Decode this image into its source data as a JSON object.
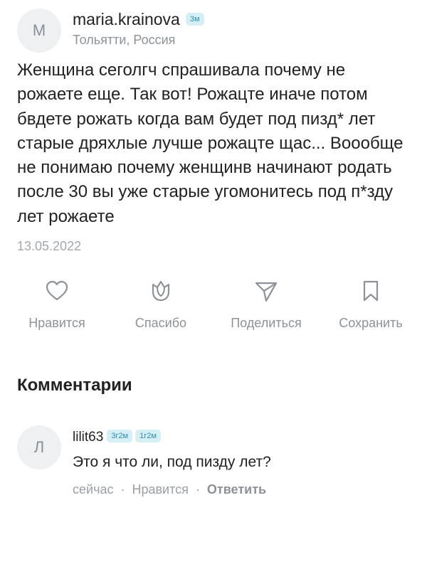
{
  "post": {
    "author": {
      "avatar_letter": "М",
      "name": "maria.krainova",
      "badge": "3м",
      "location": "Тольятти, Россия"
    },
    "text": "Женщина сеголгч спрашивала почему не рожаете еще. Так вот! Рожацте иначе потом бвдете рожать когда вам будет под пизд* лет старые дряхлые лучше рожацте щас... Воообще не понимаю почему женщинв начинают родать после 30 вы уже старые угомонитесь под п*зду лет рожаете",
    "date": "13.05.2022"
  },
  "actions": [
    {
      "label": "Нравится",
      "icon": "heart-icon"
    },
    {
      "label": "Спасибо",
      "icon": "flower-icon"
    },
    {
      "label": "Поделиться",
      "icon": "share-icon"
    },
    {
      "label": "Сохранить",
      "icon": "bookmark-icon"
    }
  ],
  "comments": {
    "title": "Комментарии",
    "items": [
      {
        "avatar_letter": "Л",
        "author": "lilit63",
        "badges": [
          "3г2м",
          "1г2м"
        ],
        "text": "Это я что ли, под пизду лет?",
        "time": "сейчас",
        "like_label": "Нравится",
        "reply_label": "Ответить",
        "separator": "·"
      }
    ]
  },
  "colors": {
    "badge_bg": "#d6eef5",
    "badge_text": "#2f8fb0",
    "muted": "#8c9298",
    "avatar_bg": "#eef0f2"
  }
}
